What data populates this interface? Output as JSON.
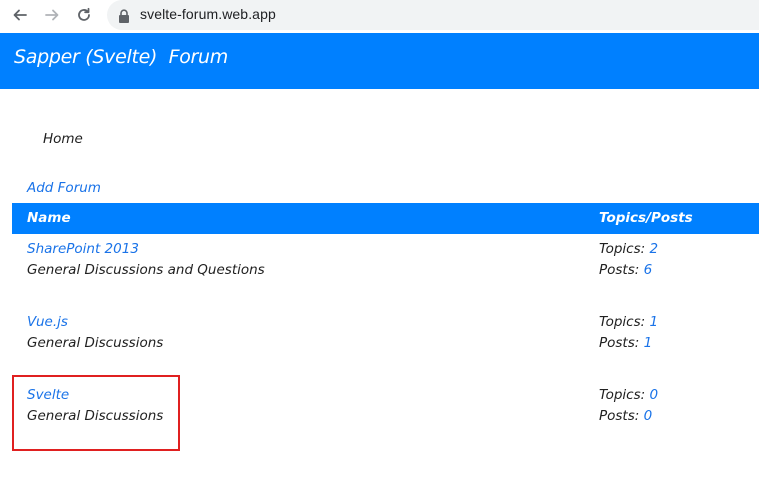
{
  "browser": {
    "url": "svelte-forum.web.app",
    "icons": [
      "back-icon",
      "forward-icon",
      "reload-icon",
      "lock-icon"
    ]
  },
  "header": {
    "title": "Sapper (Svelte)  Forum"
  },
  "breadcrumb": {
    "home": "Home"
  },
  "actions": {
    "add_forum": "Add Forum"
  },
  "table": {
    "columns": {
      "name": "Name",
      "stats": "Topics/Posts"
    },
    "topics_label": "Topics: ",
    "posts_label": "Posts: ",
    "rows": [
      {
        "name": "SharePoint 2013",
        "description": "General Discussions and Questions",
        "topics": "2",
        "posts": "6"
      },
      {
        "name": "Vue.js",
        "description": "General Discussions",
        "topics": "1",
        "posts": "1"
      },
      {
        "name": "Svelte",
        "description": "General Discussions",
        "topics": "0",
        "posts": "0"
      }
    ]
  },
  "colors": {
    "brand_blue": "#0080ff",
    "link_blue": "#1a73e8",
    "highlight_red": "#e02020"
  }
}
